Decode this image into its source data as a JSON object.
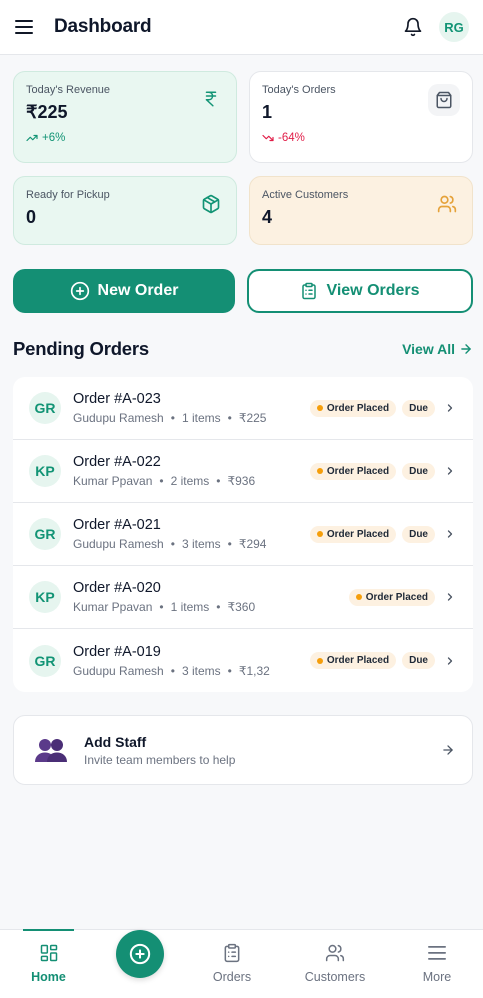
{
  "header": {
    "title": "Dashboard",
    "avatar_initials": "RG"
  },
  "stats": {
    "revenue": {
      "label": "Today's Revenue",
      "value": "₹225",
      "change": "+6%"
    },
    "orders": {
      "label": "Today's Orders",
      "value": "1",
      "change": "-64%"
    },
    "pickup": {
      "label": "Ready for Pickup",
      "value": "0"
    },
    "customers": {
      "label": "Active Customers",
      "value": "4"
    }
  },
  "actions": {
    "new_order": "New Order",
    "view_orders": "View Orders"
  },
  "pending": {
    "title": "Pending Orders",
    "view_all": "View All",
    "orders": [
      {
        "initials": "GR",
        "id": "Order #A-023",
        "customer": "Gudupu Ramesh",
        "items": "1 items",
        "amount": "₹225",
        "status": "Order Placed",
        "payment": "Due"
      },
      {
        "initials": "KP",
        "id": "Order #A-022",
        "customer": "Kumar Ppavan",
        "items": "2 items",
        "amount": "₹936",
        "status": "Order Placed",
        "payment": "Due"
      },
      {
        "initials": "GR",
        "id": "Order #A-021",
        "customer": "Gudupu Ramesh",
        "items": "3 items",
        "amount": "₹294",
        "status": "Order Placed",
        "payment": "Due"
      },
      {
        "initials": "KP",
        "id": "Order #A-020",
        "customer": "Kumar Ppavan",
        "items": "1 items",
        "amount": "₹360",
        "status": "Order Placed",
        "payment": ""
      },
      {
        "initials": "GR",
        "id": "Order #A-019",
        "customer": "Gudupu Ramesh",
        "items": "3 items",
        "amount": "₹1,32",
        "status": "Order Placed",
        "payment": "Due"
      }
    ]
  },
  "staff": {
    "title": "Add Staff",
    "subtitle": "Invite team members to help"
  },
  "nav": {
    "home": "Home",
    "orders": "Orders",
    "customers": "Customers",
    "more": "More"
  },
  "colors": {
    "accent": "#148f74",
    "positive": "#129475",
    "negative": "#e11d48",
    "warning": "#f59e0b"
  },
  "icons": {
    "menu": "menu-icon",
    "notifications": "bell-icon",
    "revenue": "rupee-icon",
    "orders": "shopping-bag-icon",
    "pickup": "package-icon",
    "customers": "users-icon",
    "new_order": "plus-circle-icon",
    "view_orders": "clipboard-icon",
    "staff": "people-icon"
  }
}
